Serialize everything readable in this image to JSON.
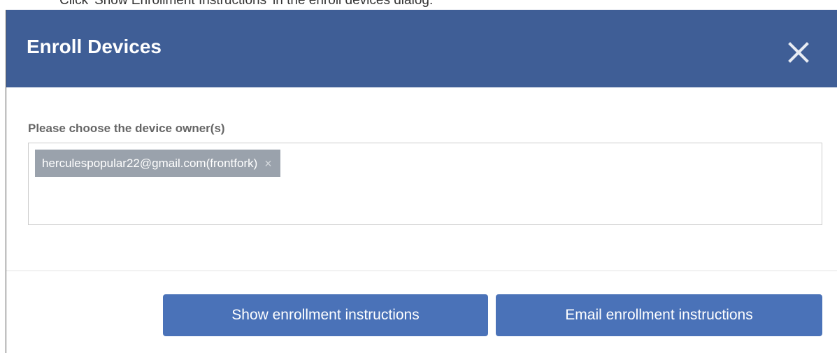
{
  "caption": "Click 'Show Enrollment Instructions' in the enroll devices dialog:",
  "dialog": {
    "title": "Enroll Devices",
    "close_icon": "close-icon",
    "owner_label": "Please choose the device owner(s)",
    "owners": [
      {
        "text": "herculespopular22@gmail.com(frontfork)",
        "remove_icon": "×"
      }
    ],
    "buttons": {
      "show_label": "Show enrollment instructions",
      "email_label": "Email enrollment instructions"
    }
  },
  "colors": {
    "header": "#3f5e96",
    "button": "#4a72b8",
    "tag": "#9aa2ac"
  }
}
